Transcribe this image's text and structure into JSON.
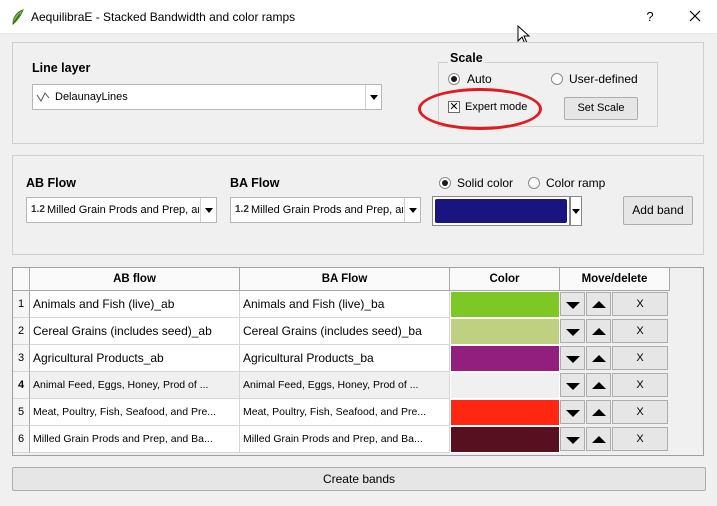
{
  "window": {
    "title": "AequilibraE - Stacked Bandwidth and color ramps",
    "help": "?"
  },
  "line_layer": {
    "label": "Line layer",
    "value": "DelaunayLines"
  },
  "scale": {
    "label": "Scale",
    "auto_label": "Auto",
    "user_defined_label": "User-defined",
    "selected": "Auto",
    "expert_mode_label": "Expert mode",
    "expert_mode_checked": true,
    "set_scale_label": "Set Scale"
  },
  "flow": {
    "ab_label": "AB Flow",
    "ab_value": "Milled Grain Prods and Prep, ar",
    "ba_label": "BA Flow",
    "ba_value": "Milled Grain Prods and Prep, ar",
    "ab_icon": "1.2",
    "ba_icon": "1.2",
    "solid_color_label": "Solid color",
    "color_ramp_label": "Color ramp",
    "selected": "Solid color",
    "color": "#191480",
    "add_band_label": "Add band"
  },
  "table": {
    "headers": [
      "AB flow",
      "BA Flow",
      "Color",
      "Move/delete"
    ],
    "rows": [
      {
        "num": "1",
        "ab": "Animals and Fish (live)_ab",
        "ba": "Animals and Fish (live)_ba",
        "color": "#7ec825",
        "del": "X"
      },
      {
        "num": "2",
        "ab": "Cereal Grains (includes seed)_ab",
        "ba": "Cereal Grains (includes seed)_ba",
        "color": "#bfd181",
        "del": "X"
      },
      {
        "num": "3",
        "ab": "Agricultural Products_ab",
        "ba": "Agricultural Products_ba",
        "color": "#921e7e",
        "del": "X"
      },
      {
        "num": "4",
        "ab": "Animal Feed, Eggs, Honey, Prod of ...",
        "ba": "Animal Feed, Eggs, Honey, Prod of ...",
        "color": "#f0f0f0",
        "del": "X"
      },
      {
        "num": "5",
        "ab": "Meat, Poultry, Fish, Seafood, and Pre...",
        "ba": "Meat, Poultry, Fish, Seafood, and Pre...",
        "color": "#ff2612",
        "del": "X"
      },
      {
        "num": "6",
        "ab": "Milled Grain Prods and Prep, and Ba...",
        "ba": "Milled Grain Prods and Prep, and Ba...",
        "color": "#561020",
        "del": "X"
      }
    ]
  },
  "create_bands_label": "Create bands",
  "annotation_color": "#e11b22"
}
